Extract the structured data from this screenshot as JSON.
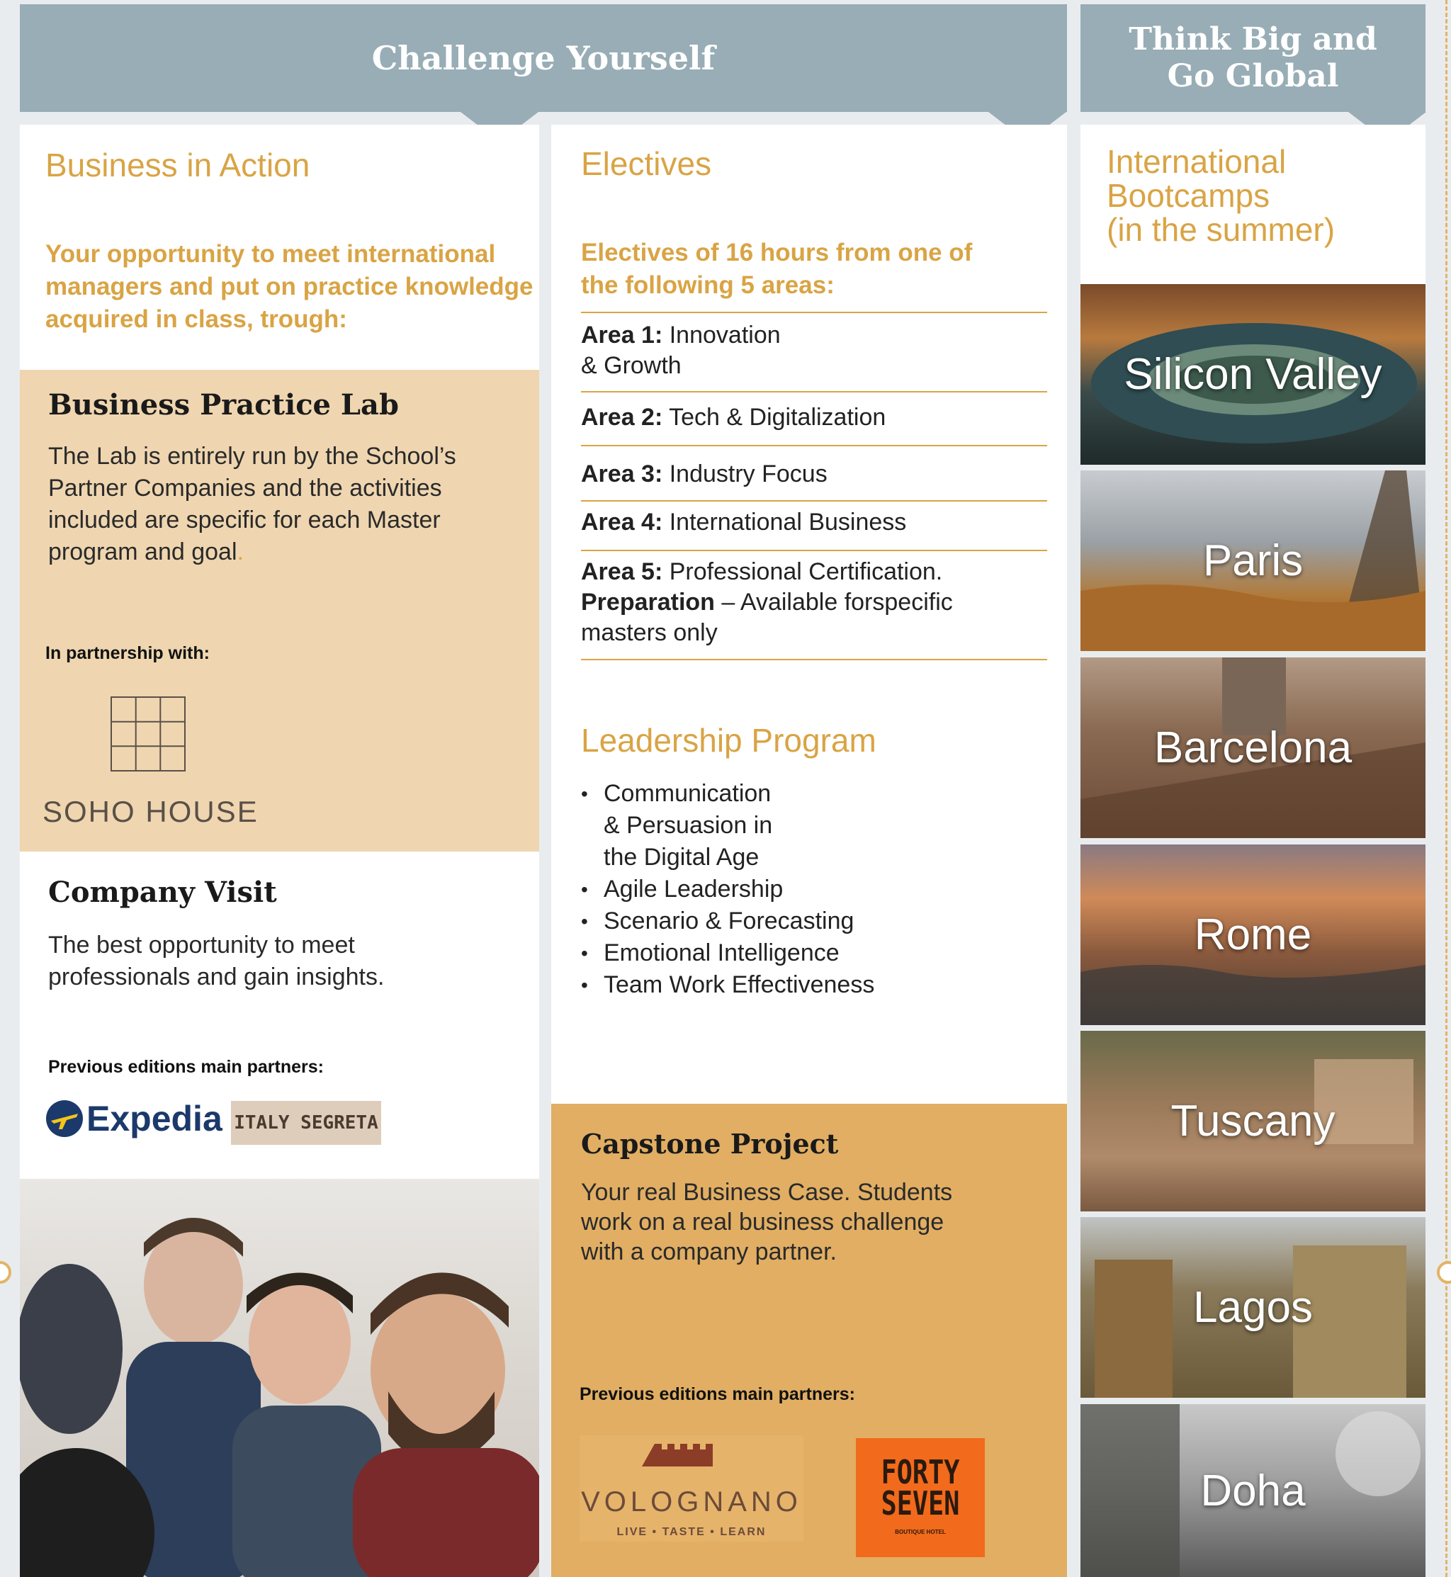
{
  "headers": {
    "challenge": "Challenge Yourself",
    "think_big_line1": "Think Big and",
    "think_big_line2": "Go Global"
  },
  "business_in_action": {
    "title": "Business in Action",
    "intro": "Your opportunity to meet international managers and put on practice knowledge acquired in class, trough:",
    "lab": {
      "title": "Business Practice Lab",
      "text": "The Lab is entirely run by the School’s Partner Companies and the activities included are specific for each Master program and goal",
      "text_end": ".",
      "partnership_label": "In partnership with:",
      "partner_logo": "SOHO HOUSE"
    },
    "company_visit": {
      "title": "Company Visit",
      "text": "The best opportunity to meet professionals and gain insights.",
      "partners_label": "Previous editions main partners:",
      "partner_1": "Expedia",
      "partner_2": "ITALY SEGRETA"
    }
  },
  "electives": {
    "title": "Electives",
    "intro": "Electives of 16 hours from one of the following 5 areas:",
    "areas": [
      {
        "label": "Area 1:",
        "text": "Innovation",
        "text2": "& Growth"
      },
      {
        "label": "Area 2:",
        "text": "Tech & Digitalization"
      },
      {
        "label": "Area 3:",
        "text": "Industry Focus"
      },
      {
        "label": "Area 4:",
        "text": "International Business"
      },
      {
        "label": "Area 5:",
        "text": "Professional Certification.",
        "label2": "Preparation",
        "text2": "– Available forspecific",
        "text3": "masters only"
      }
    ]
  },
  "leadership": {
    "title": "Leadership Program",
    "items": [
      "Communication",
      "Agile Leadership",
      "Scenario & Forecasting",
      "Emotional Intelligence",
      "Team Work Effectiveness"
    ],
    "item1_cont1": "& Persuasion in",
    "item1_cont2": "the Digital Age"
  },
  "capstone": {
    "title": "Capstone Project",
    "text": "Your real Business Case. Students work on a real business challenge with a company partner.",
    "partners_label": "Previous editions main partners:",
    "partner_1": "VOLOGNANO",
    "partner_1_tagline": "LIVE • TASTE • LEARN",
    "partner_2_line1": "FORTY",
    "partner_2_line2": "SEVEN",
    "partner_2_small": "BOUTIQUE HOTEL"
  },
  "bootcamps": {
    "title_line1": "International",
    "title_line2": "Bootcamps",
    "title_line3": "(in the summer)",
    "cities": [
      "Silicon Valley",
      "Paris",
      "Barcelona",
      "Rome",
      "Tuscany",
      "Lagos",
      "Doha"
    ]
  },
  "colors": {
    "gold": "#d9a445",
    "header_blue": "#98adb5",
    "lab_bg": "#efd6b0",
    "capstone_bg": "#e1ae63",
    "forty_seven_orange": "#f26a1b"
  }
}
